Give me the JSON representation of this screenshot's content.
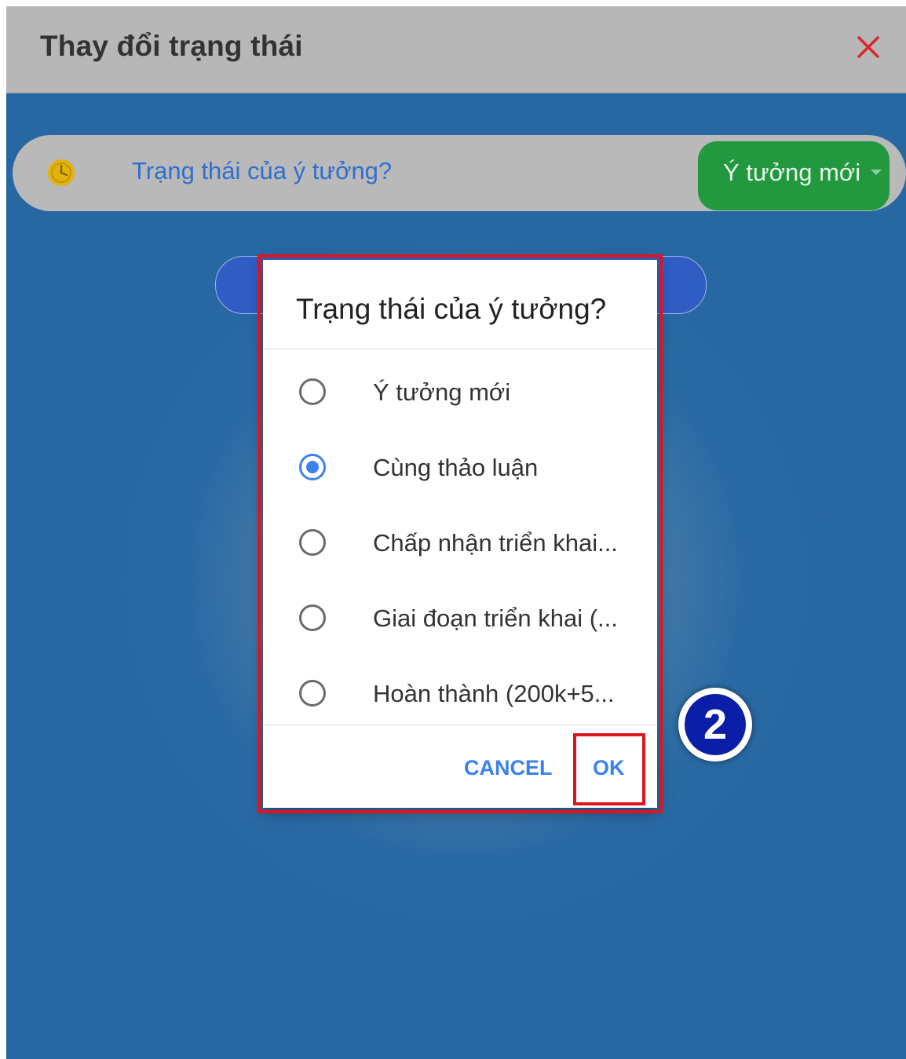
{
  "header": {
    "title": "Thay đổi trạng thái",
    "close_icon": "close-icon"
  },
  "status_bar": {
    "icon": "clock-icon",
    "label": "Trạng thái của ý tưởng?",
    "selected_value": "Ý tưởng mới"
  },
  "dialog": {
    "title": "Trạng thái của ý tưởng?",
    "options": [
      {
        "label": "Ý tưởng mới",
        "checked": false
      },
      {
        "label": "Cùng thảo luận",
        "checked": true
      },
      {
        "label": "Chấp nhận triển khai...",
        "checked": false
      },
      {
        "label": "Giai đoạn triển khai (...",
        "checked": false
      },
      {
        "label": "Hoàn thành (200k+5...",
        "checked": false
      }
    ],
    "cancel_label": "CANCEL",
    "ok_label": "OK"
  },
  "annotation": {
    "step_number": "2"
  },
  "colors": {
    "accent_blue": "#3b82f0",
    "status_green": "#22993f",
    "highlight_red": "#e0141c",
    "close_red": "#d9262c"
  }
}
